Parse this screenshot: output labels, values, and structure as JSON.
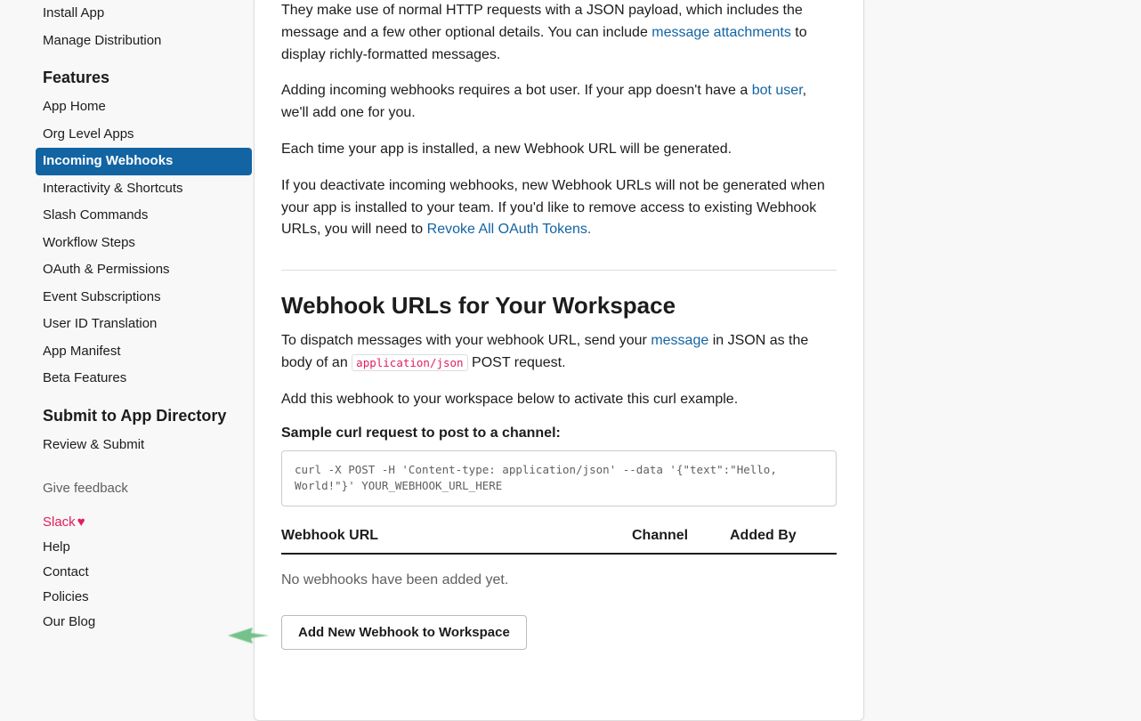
{
  "sidebar": {
    "top_items": [
      "Install App",
      "Manage Distribution"
    ],
    "features_heading": "Features",
    "feature_items": [
      "App Home",
      "Org Level Apps",
      "Incoming Webhooks",
      "Interactivity & Shortcuts",
      "Slash Commands",
      "Workflow Steps",
      "OAuth & Permissions",
      "Event Subscriptions",
      "User ID Translation",
      "App Manifest",
      "Beta Features"
    ],
    "active_feature_index": 2,
    "submit_heading": "Submit to App Directory",
    "submit_item": "Review & Submit",
    "feedback": "Give feedback",
    "footer_links": {
      "slack": "Slack",
      "help": "Help",
      "contact": "Contact",
      "policies": "Policies",
      "blog": "Our Blog"
    }
  },
  "main": {
    "intro_part1": "They make use of normal HTTP requests with a JSON payload, which includes the message and a few other optional details. You can include ",
    "intro_link1": "message attachments",
    "intro_part2": " to display richly-formatted messages.",
    "botuser_part1": "Adding incoming webhooks requires a bot user. If your app doesn't have a ",
    "botuser_link": "bot user",
    "botuser_part2": ", we'll add one for you.",
    "eachtime": "Each time your app is installed, a new Webhook URL will be generated.",
    "deactivate_part1": "If you deactivate incoming webhooks, new Webhook URLs will not be generated when your app is installed to your team. If you'd like to remove access to existing Webhook URLs, you will need to ",
    "deactivate_link": "Revoke All OAuth Tokens.",
    "section_title": "Webhook URLs for Your Workspace",
    "dispatch_part1": "To dispatch messages with your webhook URL, send your ",
    "dispatch_link": "message",
    "dispatch_part2": " in JSON as the body of an ",
    "dispatch_code": "application/json",
    "dispatch_part3": " POST request.",
    "activate_msg": "Add this webhook to your workspace below to activate this curl example.",
    "curl_label": "Sample curl request to post to a channel:",
    "curl_code": "curl -X POST -H 'Content-type: application/json' --data '{\"text\":\"Hello, World!\"}' YOUR_WEBHOOK_URL_HERE",
    "table": {
      "th_url": "Webhook URL",
      "th_channel": "Channel",
      "th_addedby": "Added By"
    },
    "empty_msg": "No webhooks have been added yet.",
    "add_button": "Add New Webhook to Workspace"
  }
}
